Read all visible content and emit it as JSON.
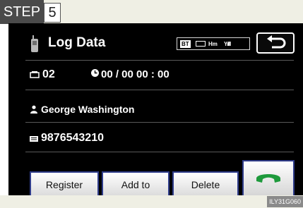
{
  "step": {
    "label": "STEP",
    "number": "5"
  },
  "header": {
    "title": "Log Data",
    "status": {
      "bt": "BT",
      "network": "Hm",
      "signal": "Yılll"
    }
  },
  "log": {
    "call_count": "02",
    "datetime": "00 / 00  00 : 00",
    "contact_name": "George Washington",
    "phone_number": "9876543210"
  },
  "buttons": {
    "register": "Register",
    "add_to": "Add to",
    "delete": "Delete"
  },
  "icons": {
    "phone": "phone-icon",
    "back": "back-arrow-icon",
    "count": "call-count-icon",
    "clock": "clock-icon",
    "person": "person-icon",
    "number": "phone-number-icon",
    "call": "green-handset-icon"
  },
  "colors": {
    "screen": "#000000",
    "button_border": "#2f3c8a",
    "call_icon": "#1e9a3c"
  },
  "figure_code": "ILY31G060"
}
